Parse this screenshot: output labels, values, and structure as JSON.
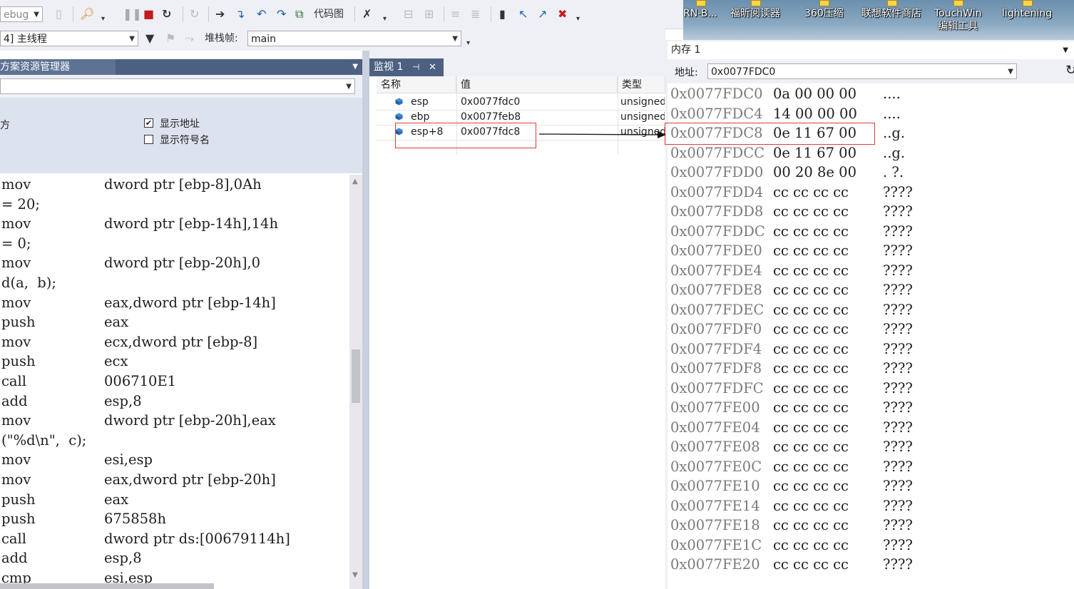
{
  "toolbar": {
    "config": "ebug",
    "code_map": "代码图"
  },
  "thread_bar": {
    "thread": "4] 主线程",
    "stack_frame_label": "堆栈帧:",
    "stack_frame": "main"
  },
  "desktop": {
    "icons": [
      "RN-B...",
      "福昕阅读器",
      "360压缩",
      "联想软件商店",
      "TouchWin\n编辑工具",
      "lightening"
    ]
  },
  "solution_explorer": {
    "title": "方案资源管理器",
    "left_label": "方",
    "show_address": "显示地址",
    "show_address_checked": true,
    "show_symbols": "显示符号名",
    "show_symbols_checked": false
  },
  "disassembly": [
    [
      "mov",
      "dword ptr [ebp-8],0Ah"
    ],
    [
      "= 20;",
      ""
    ],
    [
      "mov",
      "dword ptr [ebp-14h],14h"
    ],
    [
      "= 0;",
      ""
    ],
    [
      "mov",
      "dword ptr [ebp-20h],0"
    ],
    [
      "d(a,  b);",
      ""
    ],
    [
      "mov",
      "eax,dword ptr [ebp-14h]"
    ],
    [
      "push",
      "eax"
    ],
    [
      "mov",
      "ecx,dword ptr [ebp-8]"
    ],
    [
      "push",
      "ecx"
    ],
    [
      "call",
      "006710E1"
    ],
    [
      "add",
      "esp,8"
    ],
    [
      "mov",
      "dword ptr [ebp-20h],eax"
    ],
    [
      "(\"%d\\n\",  c);",
      ""
    ],
    [
      "mov",
      "esi,esp"
    ],
    [
      "mov",
      "eax,dword ptr [ebp-20h]"
    ],
    [
      "push",
      "eax"
    ],
    [
      "push",
      "675858h"
    ],
    [
      "call",
      "dword ptr ds:[00679114h]"
    ],
    [
      "add",
      "esp,8"
    ],
    [
      "cmp",
      "esi,esp"
    ]
  ],
  "watch": {
    "tab": "监视 1",
    "pin": "⊣",
    "close": "✕",
    "headers": {
      "name": "名称",
      "value": "值",
      "type": "类型"
    },
    "rows": [
      {
        "name": "esp",
        "value": "0x0077fdc0",
        "type": "unsigned"
      },
      {
        "name": "ebp",
        "value": "0x0077feb8",
        "type": "unsigned"
      },
      {
        "name": "esp+8",
        "value": "0x0077fdc8",
        "type": "unsigned"
      }
    ]
  },
  "memory": {
    "title": "内存 1",
    "address_label": "地址:",
    "address": "0x0077FDC0",
    "rows": [
      {
        "addr": "0x0077FDC0",
        "bytes": "0a 00 00 00",
        "ascii": "...."
      },
      {
        "addr": "0x0077FDC4",
        "bytes": "14 00 00 00",
        "ascii": "...."
      },
      {
        "addr": "0x0077FDC8",
        "bytes": "0e 11 67 00",
        "ascii": "..g."
      },
      {
        "addr": "0x0077FDCC",
        "bytes": "0e 11 67 00",
        "ascii": "..g."
      },
      {
        "addr": "0x0077FDD0",
        "bytes": "00 20 8e 00",
        "ascii": ". ?."
      },
      {
        "addr": "0x0077FDD4",
        "bytes": "cc cc cc cc",
        "ascii": "????"
      },
      {
        "addr": "0x0077FDD8",
        "bytes": "cc cc cc cc",
        "ascii": "????"
      },
      {
        "addr": "0x0077FDDC",
        "bytes": "cc cc cc cc",
        "ascii": "????"
      },
      {
        "addr": "0x0077FDE0",
        "bytes": "cc cc cc cc",
        "ascii": "????"
      },
      {
        "addr": "0x0077FDE4",
        "bytes": "cc cc cc cc",
        "ascii": "????"
      },
      {
        "addr": "0x0077FDE8",
        "bytes": "cc cc cc cc",
        "ascii": "????"
      },
      {
        "addr": "0x0077FDEC",
        "bytes": "cc cc cc cc",
        "ascii": "????"
      },
      {
        "addr": "0x0077FDF0",
        "bytes": "cc cc cc cc",
        "ascii": "????"
      },
      {
        "addr": "0x0077FDF4",
        "bytes": "cc cc cc cc",
        "ascii": "????"
      },
      {
        "addr": "0x0077FDF8",
        "bytes": "cc cc cc cc",
        "ascii": "????"
      },
      {
        "addr": "0x0077FDFC",
        "bytes": "cc cc cc cc",
        "ascii": "????"
      },
      {
        "addr": "0x0077FE00",
        "bytes": "cc cc cc cc",
        "ascii": "????"
      },
      {
        "addr": "0x0077FE04",
        "bytes": "cc cc cc cc",
        "ascii": "????"
      },
      {
        "addr": "0x0077FE08",
        "bytes": "cc cc cc cc",
        "ascii": "????"
      },
      {
        "addr": "0x0077FE0C",
        "bytes": "cc cc cc cc",
        "ascii": "????"
      },
      {
        "addr": "0x0077FE10",
        "bytes": "cc cc cc cc",
        "ascii": "????"
      },
      {
        "addr": "0x0077FE14",
        "bytes": "cc cc cc cc",
        "ascii": "????"
      },
      {
        "addr": "0x0077FE18",
        "bytes": "cc cc cc cc",
        "ascii": "????"
      },
      {
        "addr": "0x0077FE1C",
        "bytes": "cc cc cc cc",
        "ascii": "????"
      },
      {
        "addr": "0x0077FE20",
        "bytes": "cc cc cc cc",
        "ascii": "????"
      }
    ]
  },
  "colors": {
    "panel_header": "#4d6082",
    "toolbar": "#eef0f5",
    "annotation_red": "#e23b3b"
  }
}
